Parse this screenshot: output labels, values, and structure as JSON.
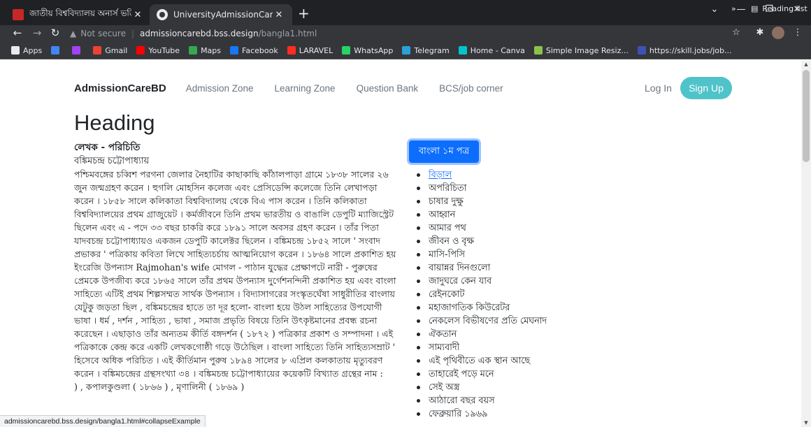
{
  "browser": {
    "tabs": [
      {
        "title": "জাতীয় বিশ্ববিদ্যালয় অনার্স ভর্তি বি",
        "active": false
      },
      {
        "title": "UniversityAdmissionCareBD",
        "active": true
      }
    ],
    "new_tab": "+",
    "url": {
      "warning": "Not secure",
      "host": "admissioncarebd.bss.design",
      "path": "/bangla1.html"
    },
    "bookmarks": [
      {
        "label": "Apps",
        "color": "#e8eaed"
      },
      {
        "label": "",
        "color": "#4285f4"
      },
      {
        "label": "",
        "color": "#a142f4"
      },
      {
        "label": "Gmail",
        "color": "#ea4335"
      },
      {
        "label": "YouTube",
        "color": "#ff0000"
      },
      {
        "label": "Maps",
        "color": "#34a853"
      },
      {
        "label": "Facebook",
        "color": "#1877f2"
      },
      {
        "label": "LARAVEL",
        "color": "#ff2d20"
      },
      {
        "label": "WhatsApp",
        "color": "#25d366"
      },
      {
        "label": "Telegram",
        "color": "#2aa1da"
      },
      {
        "label": "Home - Canva",
        "color": "#00c4cc"
      },
      {
        "label": "Simple Image Resiz...",
        "color": "#8bc34a"
      },
      {
        "label": "https://skill.jobs/job...",
        "color": "#3f51b5"
      }
    ],
    "bookmarks_overflow": "»",
    "reading_list": "Reading list",
    "status_url": "admissioncarebd.bss.design/bangla1.html#collapseExample"
  },
  "site": {
    "brand": "AdmissionCareBD",
    "nav": [
      "Admission Zone",
      "Learning Zone",
      "Question Bank",
      "BCS/job corner"
    ],
    "login": "Log In",
    "signup": "Sign Up"
  },
  "main": {
    "heading": "Heading",
    "author_title": "লেখক - পরিচিতি",
    "author_name": "বঙ্কিমচন্দ্র চট্টোপাধ্যায়",
    "bio": "পশ্চিমবঙ্গের চব্বিশ পরগনা জেলার নৈহাটির কাছাকাছি কাঁঠালপাড়া গ্রামে ১৮৩৮ সালের ২৬ জুন জন্মগ্রহণ করেন । হুগলি মোহসিন কলেজ এবং প্রেসিডেন্সি কলেজে তিনি লেখাপড়া করেন । ১৮৫৮ সালে কলিকাতা বিশ্ববিদ্যালয় থেকে বিএ পাস করেন । তিনি কলিকাতা বিশ্ববিদ্যালয়ের প্রথম গ্রাজুয়েট । কর্মজীবনে তিনি প্রথম ভারতীয় ও বাঙালি ডেপুটি ম্যাজিস্ট্রেট ছিলেন এবং এ - পদে ৩৩ বছর চাকরি করে ১৮৯১ সালে অবসর গ্রহণ করেন । তাঁর পিতা যাদবচন্দ্র চট্টোপাধ্যায়ও একজন ডেপুটি কালেক্টর ছিলেন । বঙ্কিমচন্দ্র ১৮৫২ সালে ' সংবাদ প্রভাকর ' পত্রিকায় কবিতা লিখে সাহিত্যচর্চায় আত্মনিয়োগ করেন । ১৮৬৪ সালে প্রকাশিত হয় ইংরেজি উপন্যাস Rajmohan's wife মোগল - পাঠান যুদ্ধের প্রেক্ষাপটে নারী - পুরুষের প্রেমকে উপজীব্য করে ১৮৬৫ সালে তাঁর প্রথম উপন্যাস দুর্গেশনন্দিনী প্রকাশিত হয় এবং বাংলা সাহিত্যে এটিই প্রথম শিল্পসম্মত সার্থক উপন্যাস । বিদ্যাসাগরের সংস্কৃতঘেঁষা সাধুরীতির বাংলায় যেটুকু জড়তা ছিল , বঙ্কিমচন্দ্রের হাতে তা দূর হলো- বাংলা হয়ে উঠল সাহিত্যের উপযোগী ভাষা । ধর্ম , দর্শন , সাহিত্য , ভাষা , সমাজ প্রভৃতি বিষয়ে তিনি উৎকৃষ্টমানের প্রবন্ধ রচনা করেছেন । এছাড়াও তাঁর অন্যতম কীর্তি বঙ্গদর্শন ( ১৮৭২ ) পত্রিকার প্রকাশ ও সম্পাদনা । এই পত্রিকাকে কেন্দ্র করে একটি লেখকগোষ্ঠী গড়ে উঠেছিল । বাংলা সাহিত্যে তিনি সাহিত্যসম্রাট ' হিসেবে অধিক পরিচিত । এই কীর্তিমান পুরুষ ১৮৯৪ সালের ৮ এপ্রিল কলকাতায় মৃত্যুবরণ করেন । বঙ্কিমচন্দ্রের গ্রন্থসংখ্যা ৩৪ । বঙ্কিমচন্দ্র চট্টোপাধ্যায়ের কয়েকটি বিখ্যাত গ্রন্থের নাম :",
    "books_partial": ") , কপালকুণ্ডলা ( ১৮৬৬ ) , মৃণালিনী ( ১৮৬৯ )"
  },
  "sidebar": {
    "button": "বাংলা ১ম পত্র",
    "items": [
      "বিড়াল",
      "অপরিচিতা",
      "চাষার দুক্ষু",
      "আহ্বান",
      "আমার পথ",
      "জীবন ও বৃক্ষ",
      "মাসি-পিসি",
      "বায়ান্নর দিনগুলো",
      "জাদুঘরে কেন যাব",
      "রেইনকোট",
      "মহাজাগতিক কিউরেটর",
      "নেকলেস বিভীষণের প্রতি মেঘনাদ",
      "ঐকতান",
      "সাম্যবাদী",
      "এই পৃথিবীতে এক স্থান আছে",
      "তাহারেই পড়ে মনে",
      "সেই অস্ত্র",
      "আঠারো বছর বয়স",
      "ফেব্রুয়ারি ১৯৬৯"
    ]
  }
}
